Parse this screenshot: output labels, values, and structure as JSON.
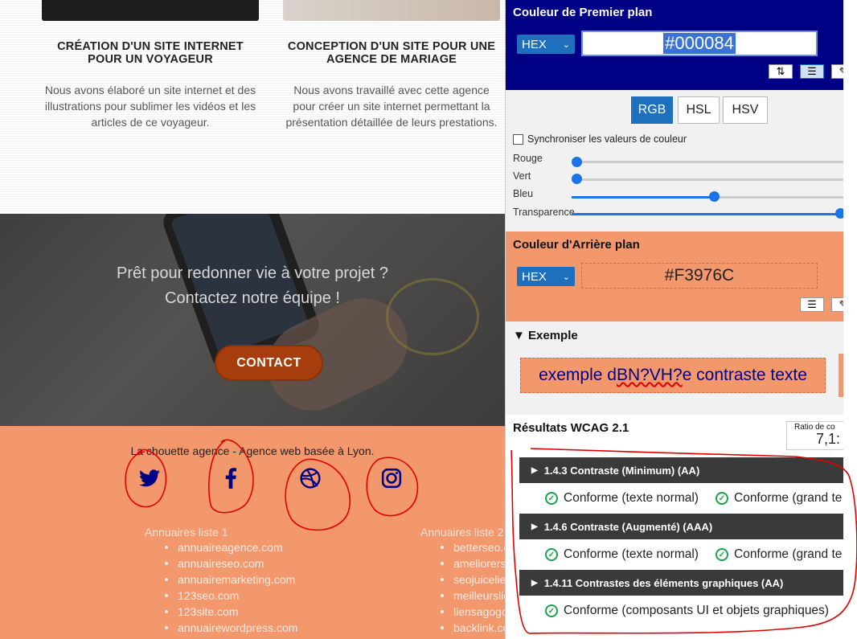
{
  "cards": [
    {
      "title_line1": "CRÉATION D'UN SITE INTERNET",
      "title_line2": "POUR UN VOYAGEUR",
      "desc_line1": "Nous avons élaboré un site internet et des",
      "desc_line2": "illustrations pour sublimer les vidéos et les",
      "desc_line3": "articles de ce voyageur."
    },
    {
      "title_line1": "CONCEPTION D'UN SITE POUR UNE",
      "title_line2": "AGENCE DE MARIAGE",
      "desc_line1": "Nous avons travaillé avec cette agence",
      "desc_line2": "pour créer un site internet permettant la",
      "desc_line3": "présentation détaillée de leurs prestations."
    }
  ],
  "hero": {
    "line1": "Prêt pour redonner vie à votre projet ?",
    "line2": "Contactez notre équipe !",
    "button": "CONTACT"
  },
  "footer": {
    "tagline": "La chouette agence - Agence web basée à Lyon.",
    "social_icons": [
      "twitter-icon",
      "facebook-icon",
      "dribbble-icon",
      "instagram-icon"
    ],
    "dir1": {
      "title": "Annuaires liste 1",
      "items": [
        "annuaireagence.com",
        "annuaireseo.com",
        "annuairemarketing.com",
        "123seo.com",
        "123site.com",
        "annuairewordpress.com"
      ]
    },
    "dir2": {
      "title": "Annuaires liste 2",
      "items": [
        "betterseo.c",
        "ameliorers",
        "seojuicelie",
        "meilleurslie",
        "liensagogo",
        "backlink.com"
      ]
    }
  },
  "panel": {
    "fg": {
      "title": "Couleur de Premier plan",
      "format": "HEX",
      "value": "#000084"
    },
    "modes": [
      "RGB",
      "HSL",
      "HSV"
    ],
    "active_mode": "RGB",
    "sync_label": "Synchroniser les valeurs de couleur",
    "sliders": [
      {
        "label": "Rouge",
        "value": 0
      },
      {
        "label": "Vert",
        "value": 0
      },
      {
        "label": "Bleu",
        "value": 132
      },
      {
        "label": "Transparence",
        "value": 1
      }
    ],
    "bg": {
      "title": "Couleur d'Arrière plan",
      "format": "HEX",
      "value": "#F3976C"
    },
    "example": {
      "title": "Exemple",
      "text_a": "exemple d ",
      "text_b": "BN?VH?",
      "text_c": "e contraste texte"
    },
    "results": {
      "title": "Résultats WCAG 2.1",
      "ratio_label": "Ratio de co",
      "ratio_value": "7,1:",
      "criteria": [
        {
          "name": "1.4.3 Contraste (Minimum) (AA)",
          "pass_a": "Conforme (texte normal)",
          "pass_b": "Conforme (grand te"
        },
        {
          "name": "1.4.6 Contraste (Augmenté) (AAA)",
          "pass_a": "Conforme (texte normal)",
          "pass_b": "Conforme (grand te"
        },
        {
          "name": "1.4.11 Contrastes des éléments graphiques (AA)",
          "pass_a": "Conforme (composants UI et objets graphiques)"
        }
      ]
    }
  },
  "colors": {
    "foreground": "#000084",
    "background": "#F3976C",
    "accent": "#1F6FBF",
    "pass": "#1AA34A",
    "annotation": "#E00000"
  }
}
